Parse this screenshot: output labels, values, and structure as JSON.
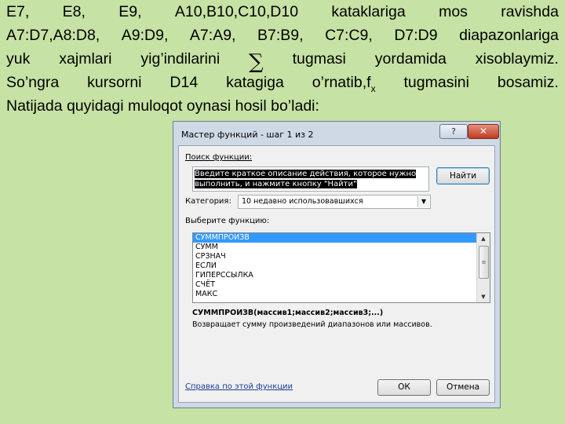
{
  "paragraph": {
    "line1": [
      "E7,",
      "E8,",
      "E9,",
      "A10,B10,C10,D10",
      "kataklariga",
      "mos",
      "ravishda"
    ],
    "line2": [
      "A7:D7,A8:D8,",
      "A9:D9,",
      "A7:A9,",
      "B7:B9,",
      "C7:C9,",
      "D7:D9",
      "diapazonlariga"
    ],
    "line3_left": [
      "yuk",
      "xajmlari",
      "yig’indilarini"
    ],
    "sigma": "∑",
    "line3_right": [
      "tugmasi",
      "yordamida",
      "xisoblaymiz."
    ],
    "line4_a": [
      "So’ngra",
      "kursorni",
      "D14",
      "katagiga"
    ],
    "line4_b": "o’rnatib,f",
    "fx_sub": "x",
    "line4_c": [
      "tugmasini",
      "bosamiz."
    ],
    "line5": "Natijada quyidagi muloqot oynasi hosil bo’ladi:"
  },
  "dialog": {
    "title": "Мастер функций - шаг 1 из 2",
    "help_btn": "?",
    "close_btn": "✕",
    "search_label": "Поиск функции:",
    "search_value_line1": "Введите краткое описание действия, которое нужно",
    "search_value_line2": "выполнить, и нажмите кнопку \"Найти\"",
    "find_button": "Найти",
    "category_label": "Категория:",
    "category_value": "10 недавно использовавшихся",
    "select_function_label": "Выберите функцию:",
    "functions": [
      "СУММПРОИЗВ",
      "СУММ",
      "СРЗНАЧ",
      "ЕСЛИ",
      "ГИПЕРССЫЛКА",
      "СЧЁТ",
      "МАКС"
    ],
    "selected_function": "СУММПРОИЗВ",
    "syntax": "СУММПРОИЗВ(массив1;массив2;массив3;...)",
    "description": "Возвращает сумму произведений диапазонов или массивов.",
    "help_link": "Справка по этой функции",
    "ok_button": "ОК",
    "cancel_button": "Отмена"
  },
  "colors": {
    "background": "#c6e2a4",
    "selection": "#3399ff",
    "link": "#1a3e99"
  }
}
